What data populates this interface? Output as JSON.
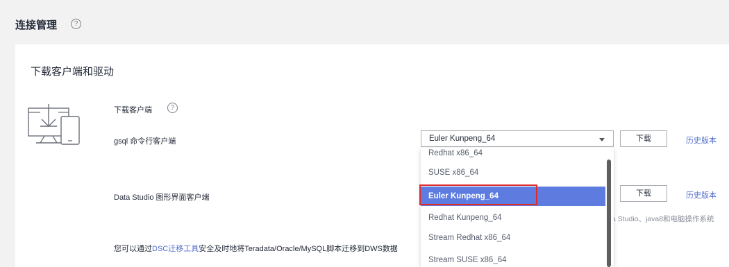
{
  "header": {
    "title": "连接管理",
    "help_glyph": "?"
  },
  "section": {
    "title": "下载客户端和驱动"
  },
  "client": {
    "heading": "下载客户端",
    "help_glyph": "?",
    "gsql_label": "gsql 命令行客户端",
    "datastudio_label": "Data Studio 图形界面客户端",
    "dsc_text_prefix": "您可以通过",
    "dsc_link": "DSC迁移工具",
    "dsc_text_suffix": "安全及时地将Teradata/Oracle/MySQL脚本迁移到DWS数据",
    "datastudio_note": "ta Studio、java8和电脑操作系统"
  },
  "select": {
    "value": "Euler Kunpeng_64",
    "options": [
      "Redhat x86_64",
      "SUSE x86_64",
      "Euler Kunpeng_64",
      "Redhat Kunpeng_64",
      "Stream Redhat x86_64",
      "Stream SUSE x86_64"
    ],
    "selected_index": 2
  },
  "buttons": {
    "download_1": "下载",
    "download_2": "下载"
  },
  "links": {
    "history_1": "历史版本",
    "history_2": "历史版本"
  },
  "colors": {
    "accent": "#5e7ce0",
    "link": "#526ecc",
    "highlight": "#e02b2b"
  },
  "icons": {
    "help": "help-circle-icon",
    "device": "download-device-icon",
    "dropdown": "chevron-down-icon"
  }
}
